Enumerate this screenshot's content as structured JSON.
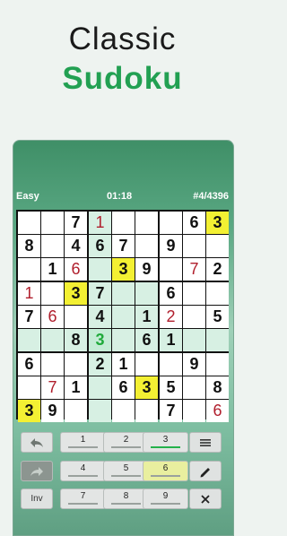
{
  "promo": {
    "title": "Classic",
    "subtitle": "Sudoku"
  },
  "status": {
    "difficulty": "Easy",
    "timer": "01:18",
    "puzzle": "#4/4396"
  },
  "board": {
    "rows": [
      [
        "",
        "",
        "7",
        "1",
        "",
        "",
        "",
        "6",
        "3"
      ],
      [
        "8",
        "",
        "4",
        "6",
        "7",
        "",
        "9",
        "",
        ""
      ],
      [
        "",
        "1",
        "6",
        "",
        "3",
        "9",
        "",
        "7",
        "2"
      ],
      [
        "1",
        "",
        "3",
        "7",
        "",
        "",
        "6",
        "",
        ""
      ],
      [
        "7",
        "6",
        "",
        "4",
        "",
        "1",
        "2",
        "",
        "5"
      ],
      [
        "",
        "",
        "8",
        "3",
        "",
        "6",
        "1",
        "",
        ""
      ],
      [
        "6",
        "",
        "",
        "2",
        "1",
        "",
        "",
        "9",
        ""
      ],
      [
        "",
        "7",
        "1",
        "",
        "6",
        "3",
        "5",
        "",
        "8"
      ],
      [
        "3",
        "9",
        "",
        "",
        "",
        "",
        "7",
        "",
        "6"
      ]
    ],
    "user_entries": [
      [
        0,
        3
      ],
      [
        2,
        2
      ],
      [
        2,
        7
      ],
      [
        3,
        0
      ],
      [
        4,
        1
      ],
      [
        4,
        6
      ],
      [
        7,
        1
      ],
      [
        8,
        8
      ]
    ],
    "selected_cell": [
      5,
      3
    ],
    "highlight_digit": "3",
    "colors": {
      "highlight": "#f3f033",
      "selected_bg": "#c5ecd6",
      "related": "#d7f0e3",
      "cell": "#ffffff",
      "given": "#111111",
      "user": "#b01e2c",
      "selected_text": "#1faa3a"
    }
  },
  "keypad": {
    "undo_icon": "undo-icon",
    "redo_icon": "redo-icon",
    "inverse_label": "Inv",
    "digits": [
      "1",
      "2",
      "3",
      "4",
      "5",
      "6",
      "7",
      "8",
      "9"
    ],
    "highlighted_digit": "6",
    "menu_icon": "menu-icon",
    "pencil_icon": "pencil-icon",
    "clear_icon": "clear-icon"
  }
}
